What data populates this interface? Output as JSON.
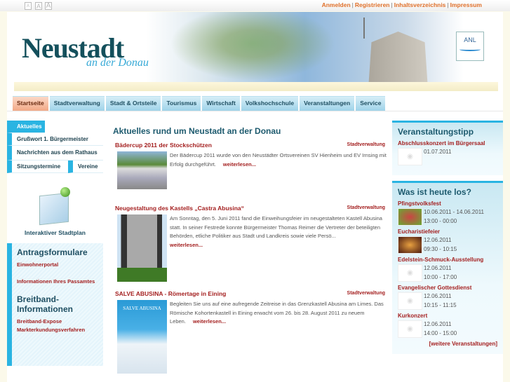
{
  "topbar": {
    "font_sizes": [
      "A",
      "A",
      "A"
    ],
    "links": [
      "Anmelden",
      "Registrieren",
      "Inhaltsverzeichnis",
      "Impressum"
    ]
  },
  "header": {
    "logo_main": "Neustadt",
    "logo_sub": "an der Donau",
    "crest_text": "ANL"
  },
  "tabs": [
    "Startseite",
    "Stadtverwaltung",
    "Stadt & Ortsteile",
    "Tourismus",
    "Wirtschaft",
    "Volkshochschule",
    "Veranstaltungen",
    "Service"
  ],
  "left": {
    "nav": [
      "Aktuelles",
      "Grußwort 1. Bürgermeister",
      "Nachrichten aus dem Rathaus",
      "Sitzungstermine",
      "Vereine"
    ],
    "map_label": "Interaktiver Stadtplan",
    "box": {
      "title1": "Antragsformulare",
      "link1": "Einwohnerportal",
      "link2": "Informationen Ihres Passamtes",
      "title2": "Breitband-Informationen",
      "link3": "Breitband-Expose Markterkundungsverfahren"
    }
  },
  "main": {
    "title": "Aktuelles rund um Neustadt an der Donau",
    "more": "weiterlesen...",
    "news": [
      {
        "title": "Bädercup 2011 der Stockschützen",
        "category": "Stadtverwaltung",
        "text": "Der Bädercup 2011 wurde von den Neustädter Ortsvereinen SV Hienheim und EV Irnsing mit Erfolg durchgeführt."
      },
      {
        "title": "Neugestaltung des Kastells „Castra Abusina“",
        "category": "Stadtverwaltung",
        "text": "Am Sonntag, den 5. Juni 2011 fand die Einweihungsfeier im neugestalteten Kastell Abusina statt. In seiner Festrede konnte Bürgermeister Thomas Reimer die Vertreter der beteiligten Behörden, etliche Politiker aus Stadt und Landkreis sowie viele Persö..."
      },
      {
        "title": "SALVE ABUSINA - Römertage in Eining",
        "category": "Stadtverwaltung",
        "text": "Begleiten Sie uns auf eine aufregende Zeitreise in das Grenzkastell Abusina am Limes. Das Römische Kohortenkastell in Eining erwacht vom 26. bis 28. August 2011 zu neuem Leben.",
        "poster": "SALVE ABUSINA"
      }
    ]
  },
  "right": {
    "tipp": {
      "title": "Veranstaltungstipp",
      "event": "Abschlusskonzert im Bürgersaal",
      "date": "01.07.2011"
    },
    "today": {
      "title": "Was ist heute los?",
      "events": [
        {
          "name": "Pfingstvolksfest",
          "date": "10.06.2011 - 14.06.2011",
          "time": "13:00 - 00:00"
        },
        {
          "name": "Eucharistiefeier",
          "date": "12.06.2011",
          "time": "09:30 - 10:15"
        },
        {
          "name": "Edelstein-Schmuck-Ausstellung",
          "date": "12.06.2011",
          "time": "10:00 - 17:00"
        },
        {
          "name": "Evangelischer Gottesdienst",
          "date": "12.06.2011",
          "time": "10:15 - 11:15"
        },
        {
          "name": "Kurkonzert",
          "date": "12.06.2011",
          "time": "14:00 - 15:00"
        }
      ],
      "more": "[weitere Veranstaltungen]"
    }
  }
}
